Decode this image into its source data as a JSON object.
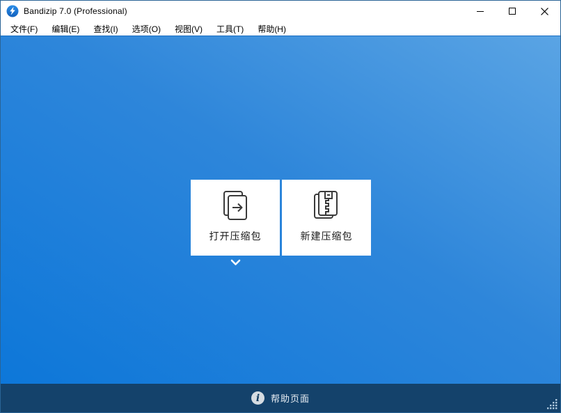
{
  "window": {
    "title": "Bandizip 7.0 (Professional)"
  },
  "titlebar": {
    "app_icon": "bandizip-lightning-circle",
    "controls": [
      {
        "name": "minimize",
        "glyph": "—"
      },
      {
        "name": "maximize",
        "glyph": "□"
      },
      {
        "name": "close",
        "glyph": "✕"
      }
    ]
  },
  "menubar": {
    "items": [
      "文件(F)",
      "编辑(E)",
      "查找(I)",
      "选项(O)",
      "视图(V)",
      "工具(T)",
      "帮助(H)"
    ]
  },
  "main": {
    "cards": [
      {
        "id": "open-archive",
        "label": "打开压缩包",
        "icon": "open-archive-icon"
      },
      {
        "id": "new-archive",
        "label": "新建压缩包",
        "icon": "new-archive-icon"
      }
    ],
    "more_chevron_icon": "chevron-down"
  },
  "statusbar": {
    "help_icon": "info-circle",
    "help_label": "帮助页面",
    "resize_grip_icon": "resize-grip-dots"
  },
  "colors": {
    "titlebar_bg": "#ffffff",
    "workspace_gradient_light": "#5aa4e4",
    "workspace_gradient_mid": "#2e86da",
    "workspace_gradient_dark": "#0d77d9",
    "statusbar_bg": "#14426b",
    "card_bg": "#ffffff",
    "app_logo_blue": "#1f7ad6",
    "icon_stroke": "#3a3a3a"
  }
}
